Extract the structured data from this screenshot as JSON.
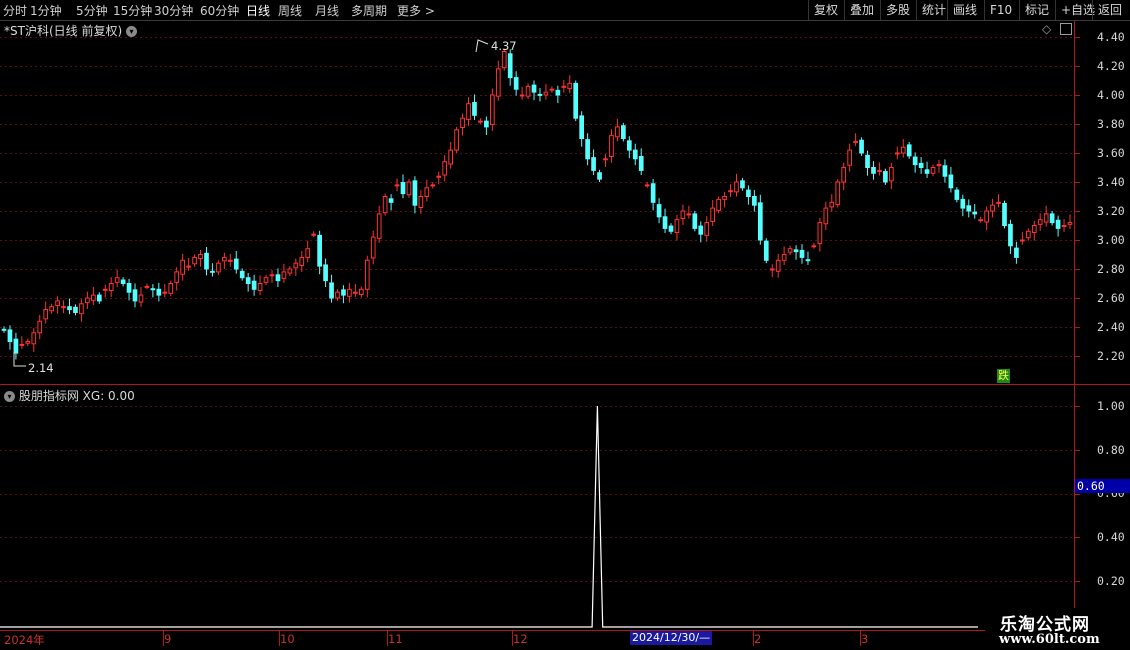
{
  "toolbar": {
    "periods": [
      "分时",
      "1分钟",
      "5分钟",
      "15分钟",
      "30分钟",
      "60分钟",
      "日线",
      "周线",
      "月线",
      "多周期",
      "更多 >"
    ],
    "active_period": "日线",
    "right_items": [
      "复权",
      "叠加",
      "多股",
      "统计",
      "画线",
      "F10",
      "标记",
      "+自选",
      "返回"
    ]
  },
  "price_panel": {
    "title": "*ST沪科(日线 前复权)",
    "high_label": "4.37",
    "low_label": "2.14",
    "signal_marker": "跌",
    "y_ticks": [
      "4.40",
      "4.20",
      "4.00",
      "3.80",
      "3.60",
      "3.40",
      "3.20",
      "3.00",
      "2.80",
      "2.60",
      "2.40",
      "2.20"
    ]
  },
  "indicator_panel": {
    "title": "股朋指标网",
    "readout": "XG: 0.00",
    "y_ticks": [
      "1.00",
      "0.80",
      "0.60",
      "0.40",
      "0.20"
    ],
    "cursor_value": "0.60"
  },
  "x_axis": {
    "labels": [
      "2024年",
      "9",
      "10",
      "11",
      "12",
      "2",
      "3"
    ],
    "cursor_date": "2024/12/30/—"
  },
  "watermark": {
    "name": "乐淘公式网",
    "url": "www.60lt.com"
  },
  "colors": {
    "up": "#ff3232",
    "down": "#54ffff",
    "grid": "#5a1010",
    "axis": "#b01818"
  },
  "chart_data": [
    {
      "type": "candlestick",
      "title": "*ST沪科(日线 前复权)",
      "ylim": [
        2.1,
        4.45
      ],
      "period_labels": [
        "2024年",
        "9",
        "10",
        "11",
        "12",
        "2",
        "3"
      ],
      "max_marker": 4.37,
      "min_marker": 2.14,
      "closes": [
        2.38,
        2.3,
        2.22,
        2.28,
        2.3,
        2.36,
        2.44,
        2.52,
        2.54,
        2.58,
        2.54,
        2.52,
        2.5,
        2.56,
        2.6,
        2.62,
        2.58,
        2.66,
        2.7,
        2.74,
        2.7,
        2.64,
        2.58,
        2.62,
        2.68,
        2.66,
        2.62,
        2.64,
        2.7,
        2.78,
        2.86,
        2.82,
        2.88,
        2.9,
        2.8,
        2.78,
        2.84,
        2.88,
        2.86,
        2.8,
        2.74,
        2.7,
        2.66,
        2.7,
        2.74,
        2.76,
        2.72,
        2.78,
        2.8,
        2.84,
        2.88,
        2.94,
        3.04,
        2.82,
        2.72,
        2.6,
        2.64,
        2.62,
        2.66,
        2.64,
        2.66,
        2.86,
        3.02,
        3.18,
        3.3,
        3.26,
        3.38,
        3.32,
        3.4,
        3.24,
        3.3,
        3.36,
        3.38,
        3.44,
        3.54,
        3.62,
        3.76,
        3.84,
        3.94,
        3.86,
        3.82,
        3.78,
        4.0,
        4.18,
        4.3,
        4.12,
        4.04,
        4.0,
        4.06,
        4.02,
        4.0,
        4.02,
        4.04,
        4.0,
        4.06,
        4.08,
        3.84,
        3.7,
        3.56,
        3.48,
        3.42,
        3.56,
        3.72,
        3.78,
        3.7,
        3.62,
        3.56,
        3.48,
        3.38,
        3.26,
        3.16,
        3.08,
        3.06,
        3.14,
        3.2,
        3.18,
        3.08,
        3.04,
        3.12,
        3.22,
        3.28,
        3.3,
        3.34,
        3.4,
        3.36,
        3.3,
        3.24,
        3.0,
        2.86,
        2.8,
        2.86,
        2.9,
        2.94,
        2.92,
        2.88,
        2.86,
        2.96,
        3.12,
        3.22,
        3.26,
        3.4,
        3.5,
        3.62,
        3.68,
        3.6,
        3.5,
        3.46,
        3.48,
        3.4,
        3.5,
        3.6,
        3.64,
        3.58,
        3.52,
        3.5,
        3.46,
        3.5,
        3.52,
        3.44,
        3.36,
        3.28,
        3.22,
        3.2,
        3.18,
        3.14,
        3.2,
        3.24,
        3.26,
        3.1,
        2.96,
        2.88,
        3.0,
        3.06,
        3.1,
        3.14,
        3.18,
        3.12,
        3.08,
        3.1,
        3.12
      ]
    },
    {
      "type": "line",
      "title": "股朋指标网",
      "series": [
        {
          "name": "XG",
          "values": [
            0,
            0,
            0,
            0,
            0,
            0,
            0,
            0,
            0,
            0,
            0,
            0,
            0,
            0,
            0,
            0,
            0,
            0,
            0,
            0,
            0,
            0,
            0,
            0,
            0,
            0,
            0,
            0,
            0,
            0,
            0,
            0,
            0,
            0,
            0,
            0,
            0,
            0,
            0,
            0,
            0,
            0,
            0,
            0,
            0,
            0,
            0,
            0,
            0,
            0,
            0,
            0,
            0,
            0,
            0,
            0,
            0,
            0,
            0,
            0,
            0,
            0,
            0,
            0,
            0,
            0,
            0,
            0,
            0,
            0,
            0,
            0,
            0,
            0,
            0,
            0,
            0,
            0,
            0,
            0,
            0,
            0,
            0,
            0,
            0,
            0,
            0,
            0,
            0,
            0,
            0,
            0,
            0,
            0,
            0,
            0,
            0,
            0,
            0,
            0,
            0,
            0,
            0,
            0,
            0,
            0,
            0,
            0,
            0,
            0,
            0,
            0,
            0,
            1,
            0,
            0,
            0,
            0,
            0,
            0,
            0,
            0,
            0,
            0,
            0,
            0,
            0,
            0,
            0,
            0,
            0,
            0,
            0,
            0,
            0,
            0,
            0,
            0,
            0,
            0,
            0,
            0,
            0,
            0,
            0,
            0,
            0,
            0,
            0,
            0,
            0,
            0,
            0,
            0,
            0,
            0,
            0,
            0,
            0,
            0,
            0,
            0,
            0,
            0,
            0,
            0,
            0,
            0,
            0,
            0,
            0,
            0,
            0,
            0,
            0,
            0,
            0,
            0,
            0,
            0,
            0,
            0,
            0,
            0,
            0,
            0
          ]
        }
      ],
      "ylim": [
        0,
        1.0
      ]
    }
  ]
}
